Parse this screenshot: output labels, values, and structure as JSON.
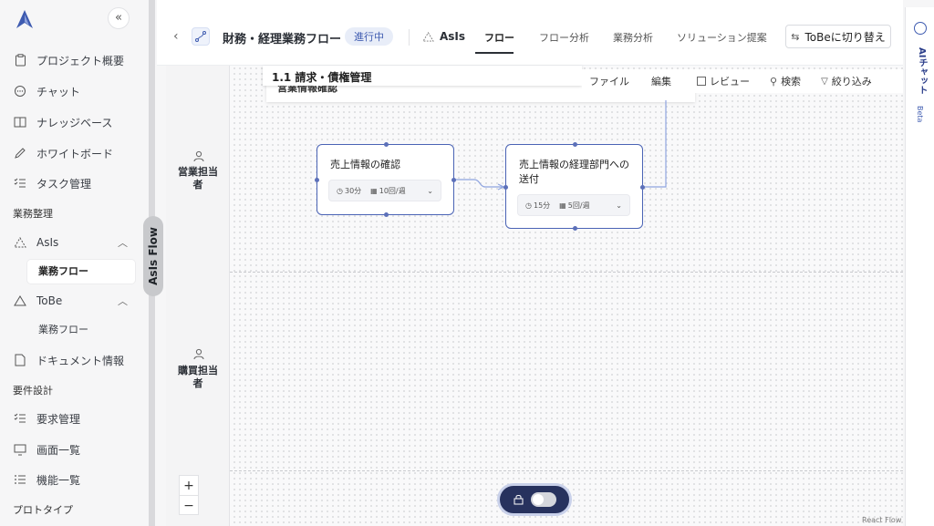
{
  "sidebar": {
    "collapse_glyph": "«",
    "items": [
      {
        "label": "プロジェクト概要",
        "icon": "clipboard-icon"
      },
      {
        "label": "チャット",
        "icon": "chat-icon"
      },
      {
        "label": "ナレッジベース",
        "icon": "book-icon"
      },
      {
        "label": "ホワイトボード",
        "icon": "pen-icon"
      },
      {
        "label": "タスク管理",
        "icon": "checklist-icon"
      }
    ],
    "section_gyomu": "業務整理",
    "asis": {
      "label": "AsIs",
      "sub": "業務フロー"
    },
    "tobe": {
      "label": "ToBe",
      "sub": "業務フロー"
    },
    "doc": "ドキュメント情報",
    "section_yoken": "要件設計",
    "yoken_items": [
      {
        "label": "要求管理",
        "icon": "checklist-icon"
      },
      {
        "label": "画面一覧",
        "icon": "monitor-icon"
      },
      {
        "label": "機能一覧",
        "icon": "list-icon"
      }
    ],
    "section_proto": "プロトタイプ",
    "vertical_tab": "AsIs Flow"
  },
  "header": {
    "title": "財務・経理業務フロー",
    "status": "進行中",
    "asis_tab": "AsIs",
    "tabs": [
      "フロー",
      "フロー分析",
      "業務分析",
      "ソリューション提案"
    ],
    "active_tab": "フロー",
    "switch_button": "ToBeに切り替え"
  },
  "ai_panel": {
    "label": "AIチャット",
    "beta": "Beta"
  },
  "canvas": {
    "sub_title": "1.1 請求・債権管理",
    "sub_sub_title": "営業情報確認",
    "menu": [
      "ファイル",
      "編集",
      "レビュー",
      "検索",
      "絞り込み"
    ],
    "lanes": [
      {
        "name": "営業担当者"
      },
      {
        "name": "購買担当者"
      }
    ],
    "nodes": [
      {
        "title": "売上情報の確認",
        "time": "30分",
        "freq": "10回/週"
      },
      {
        "title": "売上情報の経理部門への送付",
        "time": "15分",
        "freq": "5回/週"
      }
    ],
    "zoom_in": "+",
    "zoom_out": "−",
    "attribution": "React Flow"
  },
  "colors": {
    "accent": "#4a63b5",
    "status_bg": "#e8edf8",
    "pill": "#27325e"
  }
}
